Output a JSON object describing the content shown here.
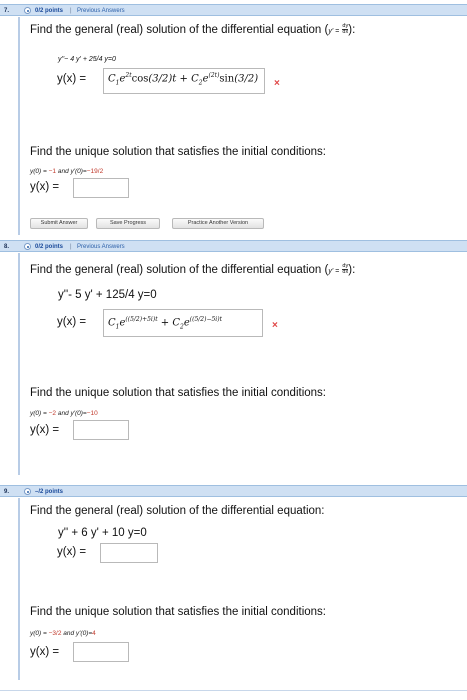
{
  "q7": {
    "number": "7.",
    "points": "0/2 points",
    "separator": "|",
    "previous": "Previous Answers",
    "prompt_prefix": "Find the general (real) solution of the differential equation (",
    "prompt_yprime": "y' =",
    "frac_num": "dy",
    "frac_den": "dx",
    "prompt_suffix": "):",
    "equation": "y''− 4 y' + 25/4 y=0",
    "yx_label": "y(x) =",
    "answer": {
      "c1": "C",
      "c1_sub": "1",
      "e1_exp": "2t",
      "func1": "cos",
      "arg1": "(3/2)t",
      "plus": "+",
      "c2": "C",
      "c2_sub": "2",
      "e2_exp": "(2t)",
      "func2": "sin",
      "arg2": "(3/2)"
    },
    "wrong_mark": "×",
    "unique_prompt": "Find the unique solution that satisfies the initial conditions:",
    "ic_y0_label": "y(0) =",
    "ic_y0_value": "−1",
    "ic_and": "and y'(0)=",
    "ic_yp0_value": "−19/2",
    "yx_label2": "y(x) =",
    "buttons": {
      "submit": "Submit Answer",
      "save": "Save Progress",
      "practice": "Practice Another Version"
    }
  },
  "q8": {
    "number": "8.",
    "points": "0/2 points",
    "separator": "|",
    "previous": "Previous Answers",
    "prompt_prefix": "Find the general (real) solution of the differential equation (",
    "prompt_yprime": "y' =",
    "frac_num": "dy",
    "frac_den": "dx",
    "prompt_suffix": "):",
    "equation": "y''- 5 y' + 125/4 y=0",
    "yx_label": "y(x) =",
    "answer": {
      "c1": "C",
      "c1_sub": "1",
      "e1_exp": "((5/2)+5i)t",
      "plus": "+",
      "c2": "C",
      "c2_sub": "2",
      "e2_exp": "((5/2)−5i)t"
    },
    "wrong_mark": "×",
    "unique_prompt": "Find the unique solution that satisfies the initial conditions:",
    "ic_y0_label": "y(0) =",
    "ic_y0_value": "−2",
    "ic_and": "and y'(0)=",
    "ic_yp0_value": "−10",
    "yx_label2": "y(x) ="
  },
  "q9": {
    "number": "9.",
    "points": "–/2 points",
    "prompt": "Find the general (real) solution of the differential equation:",
    "equation": "y'' + 6 y' + 10 y=0",
    "yx_label": "y(x) =",
    "unique_prompt": "Find the unique solution that satisfies the initial conditions:",
    "ic_y0_label": "y(0) =",
    "ic_y0_value": "−3/2",
    "ic_and": "and y'(0)=",
    "ic_yp0_value": "4",
    "yx_label2": "y(x) ="
  },
  "colors": {
    "header_bg": "#cfe0f3",
    "points_blue": "#1b4a9a",
    "wrong_red": "#e04646",
    "ic_red": "#c0392b"
  }
}
